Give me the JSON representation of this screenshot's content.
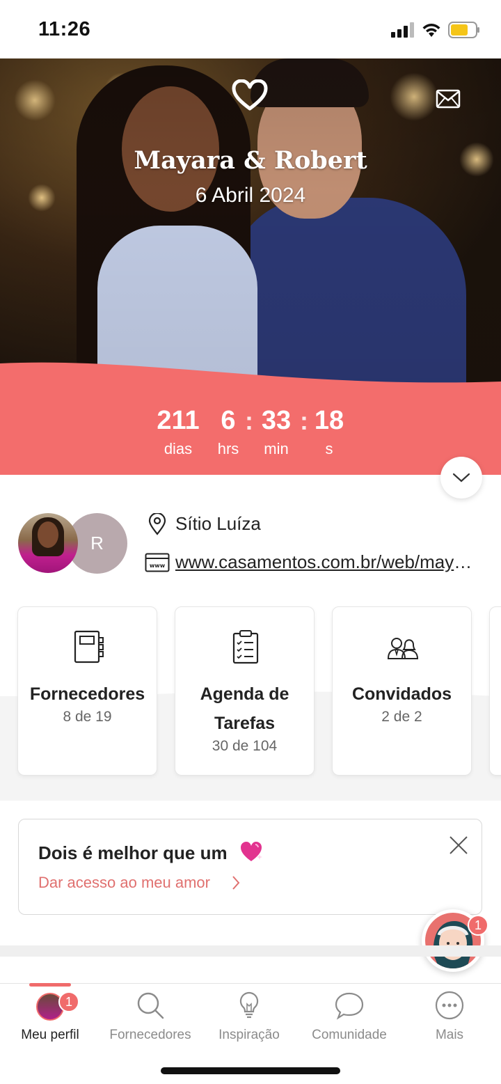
{
  "status_bar": {
    "time": "11:26"
  },
  "hero": {
    "couple_names": "Mayara & Robert",
    "wedding_date": "6 Abril 2024"
  },
  "countdown": {
    "days": "211",
    "days_label": "dias",
    "hours": "6",
    "hours_label": "hrs",
    "minutes": "33",
    "minutes_label": "min",
    "seconds": "18",
    "seconds_label": "s",
    "separator": ":"
  },
  "profile": {
    "partner_initial": "R",
    "location": "Sítio Luíza",
    "website": "www.casamentos.com.br/web/mayara-e-robert"
  },
  "cards": [
    {
      "title": "Fornecedores",
      "count": "8 de 19",
      "icon": "notebook-icon"
    },
    {
      "title": "Agenda de Tarefas",
      "count": "30 de 104",
      "icon": "checklist-icon"
    },
    {
      "title": "Convidados",
      "count": "2 de 2",
      "icon": "guests-icon"
    }
  ],
  "banner": {
    "title": "Dois é melhor que um",
    "link": "Dar acesso ao meu amor"
  },
  "assistant": {
    "badge": "1"
  },
  "tabs": [
    {
      "label": "Meu perfil",
      "badge": "1",
      "active": true
    },
    {
      "label": "Fornecedores"
    },
    {
      "label": "Inspiração"
    },
    {
      "label": "Comunidade"
    },
    {
      "label": "Mais"
    }
  ],
  "colors": {
    "accent": "#f06b6b",
    "countdown_bg": "#f36d6c",
    "text": "#222222"
  }
}
